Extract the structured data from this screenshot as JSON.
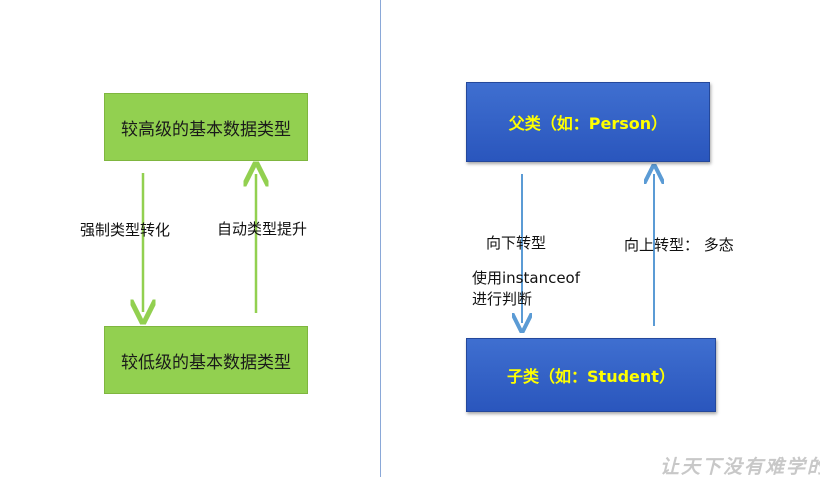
{
  "left": {
    "high_box": "较高级的基本数据类型",
    "low_box": "较低级的基本数据类型",
    "down_label": "强制类型转化",
    "up_label": "自动类型提升",
    "arrow_color": "#92d050"
  },
  "right": {
    "parent_box": "父类（如：Person）",
    "child_box": "子类（如：Student）",
    "down_label": "向下转型",
    "down_note_line1": "使用instanceof",
    "down_note_line2": "进行判断",
    "up_label": "向上转型：  多态",
    "arrow_color": "#5b9bd5"
  },
  "watermark": "让天下没有难学的"
}
